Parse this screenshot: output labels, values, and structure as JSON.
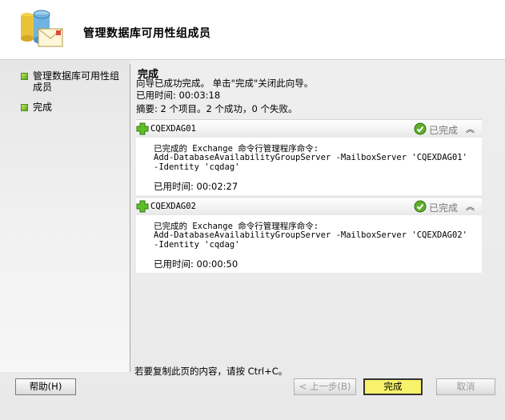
{
  "window": {
    "title": "管理数据库可用性组成员"
  },
  "nav": {
    "items": [
      {
        "label": "管理数据库可用性组成员",
        "state": "complete"
      },
      {
        "label": "完成",
        "state": "current"
      }
    ]
  },
  "main": {
    "title": "完成",
    "intro": "向导已成功完成。 单击\"完成\"关闭此向导。",
    "elapsed": "已用时间: 00:03:18",
    "summary": "摘要: 2 个项目。2 个成功，0 个失败。",
    "items": [
      {
        "name": "CQEXDAG01",
        "status": "已完成",
        "line1": "已完成的 Exchange 命令行管理程序命令:",
        "line2": "Add-DatabaseAvailabilityGroupServer -MailboxServer 'CQEXDAG01'",
        "line3": "-Identity 'cqdag'",
        "elapsed": "已用时间: 00:02:27"
      },
      {
        "name": "CQEXDAG02",
        "status": "已完成",
        "line1": "已完成的 Exchange 命令行管理程序命令:",
        "line2": "Add-DatabaseAvailabilityGroupServer -MailboxServer 'CQEXDAG02'",
        "line3": "-Identity 'cqdag'",
        "elapsed": "已用时间: 00:00:50"
      }
    ],
    "copy_hint": "若要复制此页的内容，请按 Ctrl+C。"
  },
  "buttons": {
    "help": "帮助(H)",
    "back": "< 上一步(B)",
    "finish": "完成",
    "cancel": "取消"
  },
  "colors": {
    "accent_green": "#5fa51e",
    "finish_highlight": "#f7f26a"
  },
  "icons": {
    "header": "database-mail-icon",
    "item": "green-plus-icon",
    "status": "green-check-icon",
    "collapse": "double-chevron-up-icon"
  }
}
